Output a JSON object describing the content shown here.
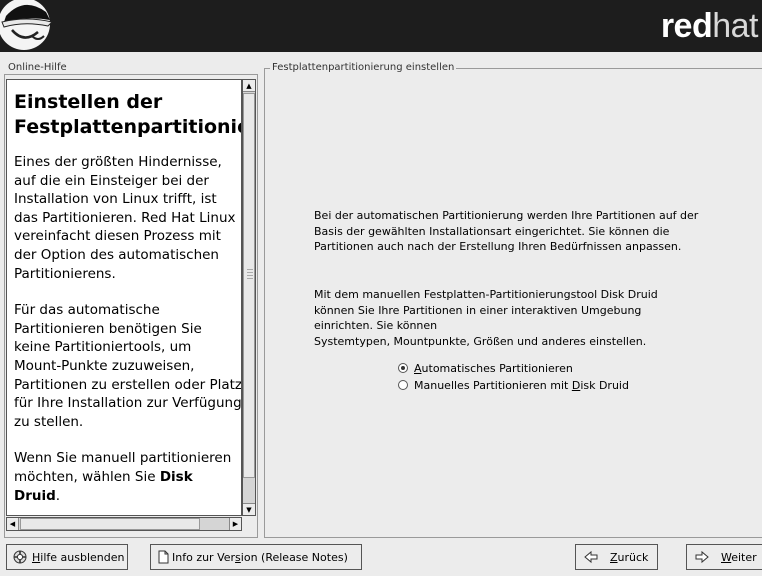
{
  "brand": {
    "bold": "red",
    "light": "hat"
  },
  "help": {
    "frame_label": "Online-Hilfe",
    "title_line1": "Einstellen der",
    "title_line2": "Festplattenpartitionierung",
    "p1": "Eines der größten Hindernisse, auf die ein Einsteiger bei der Installation von Linux trifft, ist das Partitionieren. Red Hat Linux vereinfacht diesen Prozess mit der Option des automatischen Partitionierens.",
    "p2": "Für das automatische Partitionieren benötigen Sie keine Partitioniertools, um Mount-Punkte zuzuweisen, Partitionen zu erstellen oder Platz für Ihre Installation zur Verfügung zu stellen.",
    "p3_prefix": "Wenn Sie manuell partitionieren möchten, wählen Sie ",
    "p3_bold": "Disk Druid",
    "p3_suffix": "."
  },
  "main": {
    "frame_label": "Festplattenpartitionierung einstellen",
    "para1": "Bei der automatischen Partitionierung werden Ihre Partitionen auf der Basis der gewählten Installationsart eingerichtet. Sie können die Partitionen auch nach der Erstellung Ihren Bedürfnissen anpassen.",
    "para2_lines": [
      "Mit dem manuellen Festplatten-Partitionierungstool Disk Druid",
      "können Sie Ihre Partitionen in einer interaktiven Umgebung",
      "einrichten. Sie können",
      "Systemtypen, Mountpunkte, Größen und anderes einstellen."
    ],
    "options": [
      {
        "mnemonic": "A",
        "rest": "utomatisches Partitionieren",
        "selected": true
      },
      {
        "pre": "Manuelles Partitionieren mit ",
        "mnemonic": "D",
        "rest": "isk Druid",
        "selected": false
      }
    ]
  },
  "buttons": {
    "hide_help": {
      "mnemonic": "H",
      "rest": "ilfe ausblenden"
    },
    "release_notes": {
      "pre": "Info zur Ver",
      "mnemonic": "s",
      "rest": "ion (Release Notes)"
    },
    "back": {
      "mnemonic": "Z",
      "rest": "urück"
    },
    "next": {
      "mnemonic": "W",
      "rest": "eiter"
    }
  }
}
